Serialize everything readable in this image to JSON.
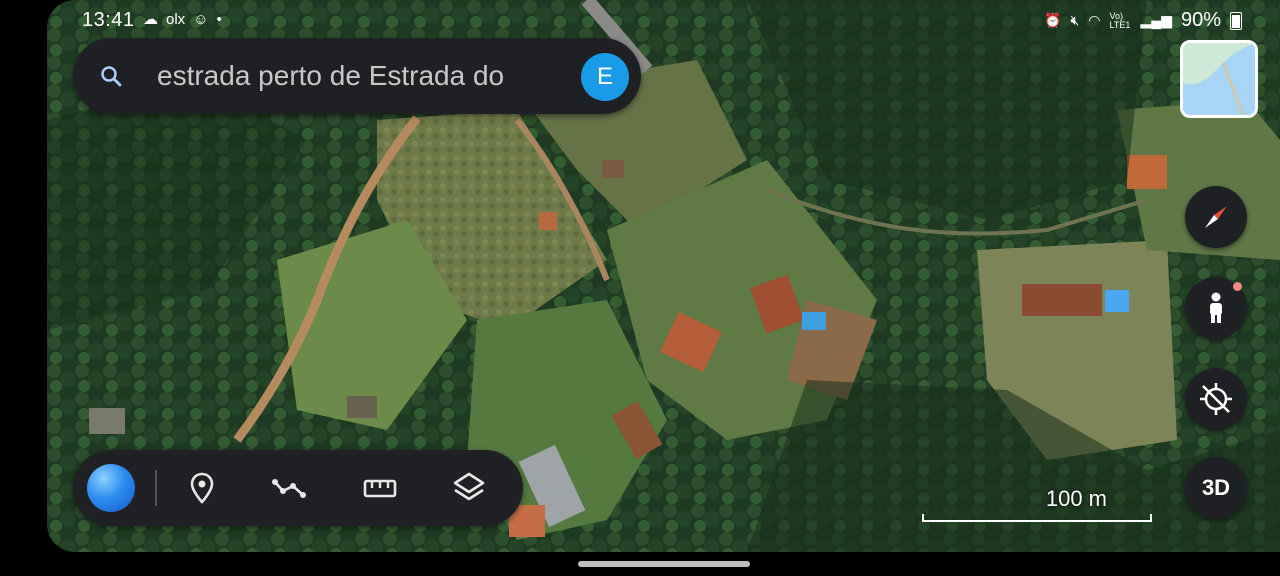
{
  "status_bar": {
    "time": "13:41",
    "left_icons": [
      "weather-icon",
      "olx-icon",
      "notification-icon",
      "dot"
    ],
    "olx_text": "olx",
    "network_text": "Vo) LTE1",
    "battery": "90%"
  },
  "search": {
    "icon": "search-icon",
    "text": "estrada perto de Estrada do",
    "avatar_initial": "E",
    "avatar_color": "#1a9be8"
  },
  "map": {
    "minimap": "minimap-thumbnail",
    "scale_label": "100 m"
  },
  "controls": {
    "compass": "compass-icon",
    "street_view": "pegman-icon",
    "location": "location-off-icon",
    "three_d_label": "3D"
  },
  "toolbar": {
    "items": [
      "earth-icon",
      "place-marker-icon",
      "path-icon",
      "ruler-icon",
      "layers-icon"
    ]
  },
  "colors": {
    "panel": "#1f2023",
    "compass_red": "#e74c3c",
    "accent_blue": "#1a9be8"
  }
}
